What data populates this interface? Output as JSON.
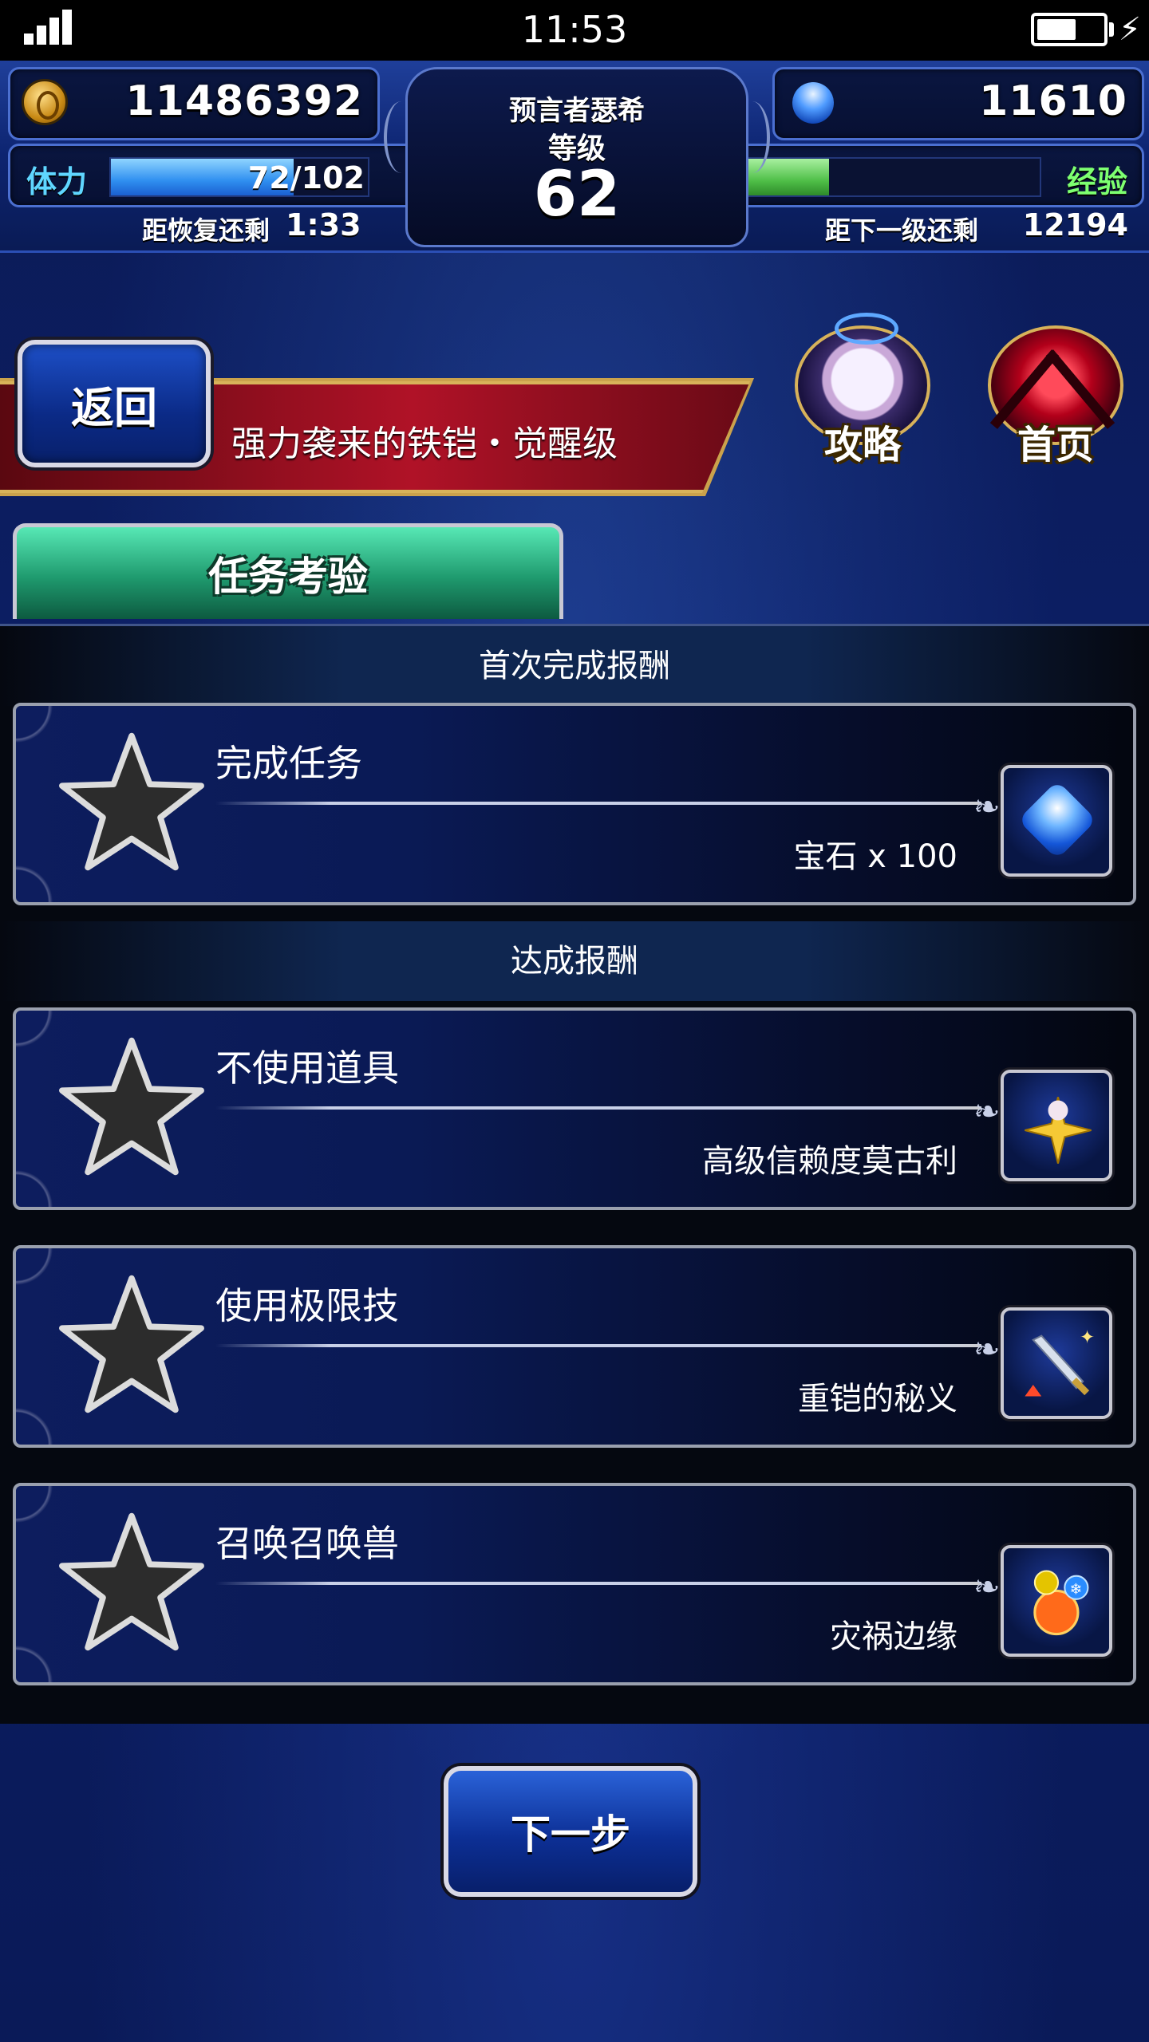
{
  "status_bar": {
    "time": "11:53",
    "battery_level": 0.6
  },
  "header": {
    "gil": "11486392",
    "gems": "11610",
    "player_name": "预言者瑟希",
    "level_label": "等级",
    "level": "62",
    "stamina_label": "体力",
    "stamina_text": "72/102",
    "stamina_fraction": 0.71,
    "recover_label": "距恢复还剩",
    "recover_time": "1:33",
    "exp_label": "经验",
    "exp_fraction": 0.4,
    "next_level_label": "距下一级还剩",
    "next_level_exp": "12194"
  },
  "banner": {
    "back_label": "返回",
    "stage_title": "强力袭来的铁铠・觉醒级",
    "guide_label": "攻略",
    "home_label": "首页"
  },
  "tab": {
    "label": "任务考验"
  },
  "sections": {
    "first_clear_title": "首次完成报酬",
    "achievement_title": "达成报酬"
  },
  "first_clear": [
    {
      "task": "完成任务",
      "reward": "宝石 x 100",
      "icon": "gem-icon"
    }
  ],
  "achievements": [
    {
      "task": "不使用道具",
      "reward": "高级信赖度莫古利",
      "icon": "moogle-star-icon"
    },
    {
      "task": "使用极限技",
      "reward": "重铠的秘义",
      "icon": "sword-icon"
    },
    {
      "task": "召唤召唤兽",
      "reward": "灾祸边缘",
      "icon": "element-orb-icon"
    }
  ],
  "footer": {
    "next_label": "下一步"
  },
  "colors": {
    "stamina": "#3fa8ff",
    "exp": "#5fd05a",
    "tab": "#2fc48f",
    "banner": "#b01227"
  }
}
